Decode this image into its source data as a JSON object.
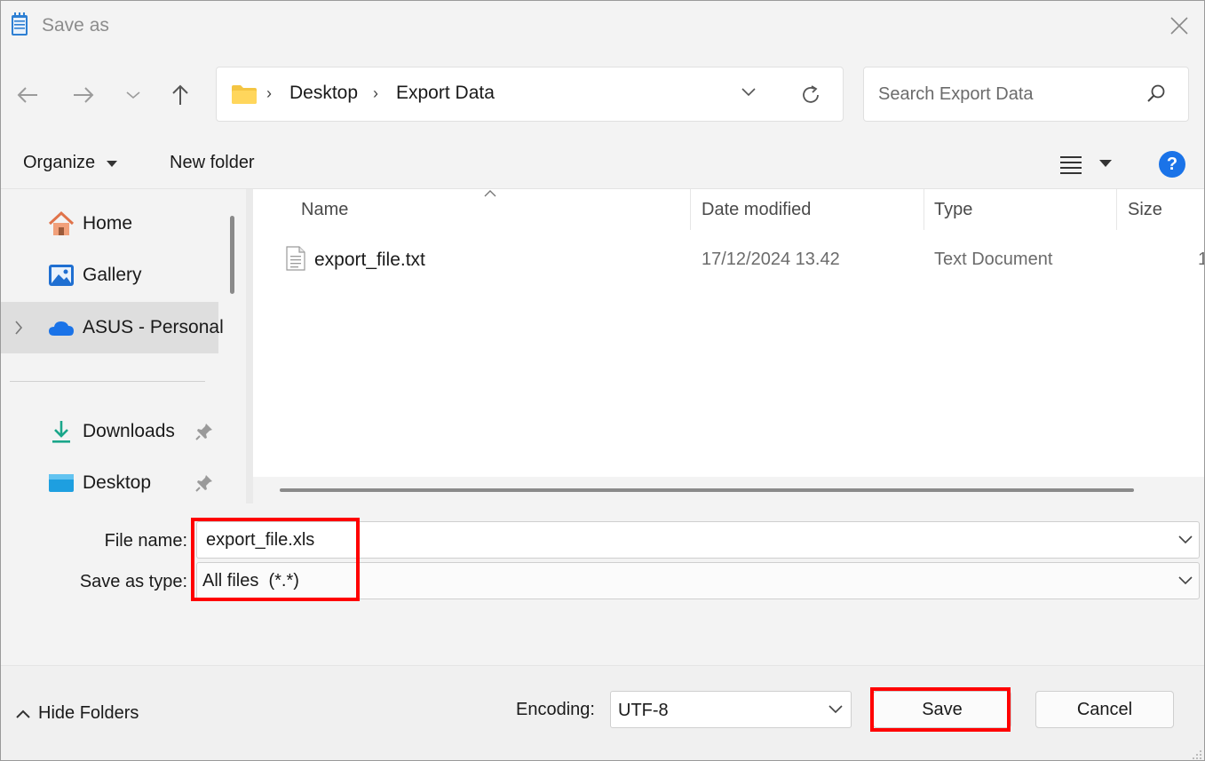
{
  "window": {
    "title": "Save as"
  },
  "address": {
    "crumbs": [
      "Desktop",
      "Export Data"
    ]
  },
  "search": {
    "placeholder": "Search Export Data"
  },
  "toolbar": {
    "organize_label": "Organize",
    "new_folder_label": "New folder",
    "help_label": "?"
  },
  "sidebar": {
    "items": [
      {
        "label": "Home",
        "icon": "home-icon"
      },
      {
        "label": "Gallery",
        "icon": "gallery-icon"
      },
      {
        "label": "ASUS - Personal",
        "icon": "onedrive-cloud-icon",
        "selected": true
      },
      {
        "label": "Downloads",
        "icon": "downloads-icon",
        "pinned": true
      },
      {
        "label": "Desktop",
        "icon": "desktop-icon",
        "pinned": true
      }
    ]
  },
  "file_list": {
    "columns": [
      "Name",
      "Date modified",
      "Type",
      "Size"
    ],
    "rows": [
      {
        "name": "export_file.txt",
        "date": "17/12/2024 13.42",
        "type": "Text Document",
        "size": "1"
      }
    ]
  },
  "form": {
    "file_name_label": "File name:",
    "file_name_value": "export_file.xls",
    "save_type_label": "Save as type:",
    "save_type_value": "All files  (*.*)"
  },
  "bottom": {
    "hide_folders_label": "Hide Folders",
    "encoding_label": "Encoding:",
    "encoding_value": "UTF-8",
    "save_label": "Save",
    "cancel_label": "Cancel"
  },
  "colors": {
    "highlight": "#ff0000",
    "accent": "#1a73e8"
  }
}
